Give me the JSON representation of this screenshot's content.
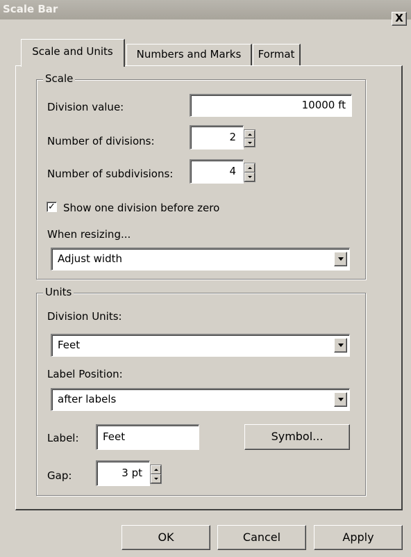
{
  "window": {
    "title": "Scale Bar",
    "close_label": "X"
  },
  "tabs": [
    {
      "label": "Scale and Units",
      "active": true
    },
    {
      "label": "Numbers and Marks",
      "active": false
    },
    {
      "label": "Format",
      "active": false
    }
  ],
  "scale_group": {
    "title": "Scale",
    "division_value_label": "Division value:",
    "division_value": "10000 ft",
    "num_divisions_label": "Number of divisions:",
    "num_divisions": "2",
    "num_subdivisions_label": "Number of subdivisions:",
    "num_subdivisions": "4",
    "show_one_division_label": "Show one division before zero",
    "show_one_division_checked": true,
    "check_glyph": "✓",
    "when_resizing_label": "When resizing...",
    "when_resizing_value": "Adjust width"
  },
  "units_group": {
    "title": "Units",
    "division_units_label": "Division Units:",
    "division_units_value": "Feet",
    "label_position_label": "Label Position:",
    "label_position_value": "after labels",
    "label_label": "Label:",
    "label_value": "Feet",
    "symbol_button": "Symbol...",
    "gap_label": "Gap:",
    "gap_value": "3 pt"
  },
  "buttons": {
    "ok": "OK",
    "cancel": "Cancel",
    "apply": "Apply"
  }
}
